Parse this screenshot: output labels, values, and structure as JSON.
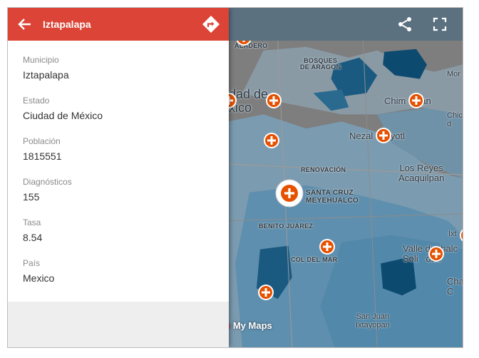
{
  "panel": {
    "title": "Iztapalapa",
    "fields": [
      {
        "label": "Municipio",
        "value": "Iztapalapa"
      },
      {
        "label": "Estado",
        "value": "Ciudad de México"
      },
      {
        "label": "Población",
        "value": "1815551"
      },
      {
        "label": "Diagnósticos",
        "value": "155"
      },
      {
        "label": "Tasa",
        "value": "8.54"
      },
      {
        "label": "País",
        "value": "Mexico"
      }
    ]
  },
  "map": {
    "labels": {
      "aladero": "ALADERO",
      "bosques": "BOSQUES\nDE ARAGON",
      "ciudad": "dad de\nxico",
      "chimalhuacan": "Chim  acán",
      "mor": "Mor",
      "chic": "Chic\nd",
      "nezahualcoyotl": "Nezal   cóyotl",
      "renovacion": "RENOVACIÓN",
      "reyes": "Los Reyes\nAcaquilpan",
      "santa_cruz": "SANTA CRUZ\nMEYEHUALCO",
      "benito": "BENITO JUÁREZ",
      "col_del_mar": "COL DEL MAR",
      "valle": "Valle de  halc\nSoli   dad",
      "ixt": "Ixt",
      "cha": "Cha\nC",
      "san_juan": "San Juan\nIxtayopan"
    },
    "branding": {
      "prefix": "e",
      "text": " My Maps"
    }
  },
  "colors": {
    "header_red": "#db4437",
    "marker_orange": "#e65100",
    "toolbar": "#5b7180",
    "water_blue": "#5288aa",
    "deep_blue": "#0d4a70"
  },
  "icons": {
    "back": "arrow-left-icon",
    "directions": "directions-icon",
    "share": "share-icon",
    "fullscreen": "fullscreen-icon",
    "marker": "plus-marker-icon"
  }
}
